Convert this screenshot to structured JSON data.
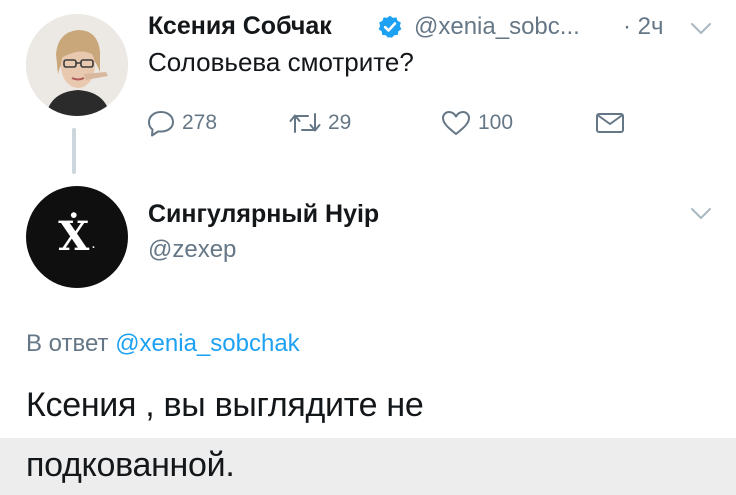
{
  "tweet_parent": {
    "author_name": "Ксения Собчак",
    "verified": true,
    "handle": "@xenia_sobc...",
    "time": "· 2ч",
    "text": "Соловьева смотрите?",
    "actions": {
      "reply_count": "278",
      "retweet_count": "29",
      "like_count": "100"
    }
  },
  "tweet_reply": {
    "author_name": "Сингулярный Нуір",
    "handle": "@zexep",
    "avatar_glyph": "Ẋ",
    "avatar_dot": ".",
    "reply_prefix": "В ответ",
    "reply_to": "@xenia_sobchak",
    "text_line1": "Ксения , вы выглядите не",
    "text_line2": "подкованной."
  },
  "icons": [
    "verified-icon",
    "chevron-down-icon",
    "reply-icon",
    "retweet-icon",
    "like-icon",
    "direct-message-icon"
  ],
  "colors": {
    "text": "#14171a",
    "secondary": "#657786",
    "accent": "#1da1f2",
    "thread_line": "#ccd6dd"
  }
}
